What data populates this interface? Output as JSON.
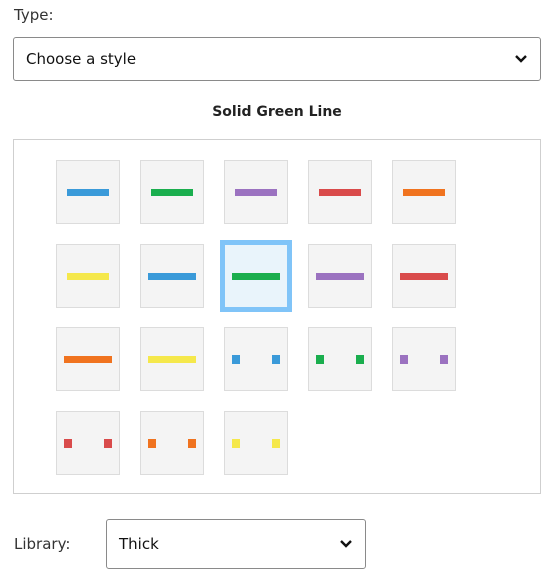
{
  "type": {
    "label": "Type:",
    "selected": "Choose a style"
  },
  "style_title": "Solid Green Line",
  "swatches": [
    {
      "name": "solid-blue-line",
      "kind": "solid",
      "color": "#3a9ad9"
    },
    {
      "name": "solid-green-line",
      "kind": "solid",
      "color": "#1aae4e"
    },
    {
      "name": "solid-purple-line",
      "kind": "solid",
      "color": "#9b72c0"
    },
    {
      "name": "solid-red-line",
      "kind": "solid",
      "color": "#d94b4b"
    },
    {
      "name": "solid-orange-line",
      "kind": "solid",
      "color": "#f0731f"
    },
    {
      "name": "solid-yellow-line",
      "kind": "solid",
      "color": "#f5e84b"
    },
    {
      "name": "solid-blue-line-long",
      "kind": "solid-long",
      "color": "#3a9ad9"
    },
    {
      "name": "solid-green-line-long",
      "kind": "solid-long",
      "color": "#1aae4e",
      "selected": true
    },
    {
      "name": "solid-purple-line-long",
      "kind": "solid-long",
      "color": "#9b72c0"
    },
    {
      "name": "solid-red-line-long",
      "kind": "solid-long",
      "color": "#d94b4b"
    },
    {
      "name": "solid-orange-line-long",
      "kind": "solid-long",
      "color": "#f0731f"
    },
    {
      "name": "solid-yellow-line-long",
      "kind": "solid-long",
      "color": "#f5e84b"
    },
    {
      "name": "dashed-blue-line",
      "kind": "dashed",
      "color": "#3a9ad9"
    },
    {
      "name": "dashed-green-line",
      "kind": "dashed",
      "color": "#1aae4e"
    },
    {
      "name": "dashed-purple-line",
      "kind": "dashed",
      "color": "#9b72c0"
    },
    {
      "name": "dashed-red-line",
      "kind": "dashed",
      "color": "#d94b4b"
    },
    {
      "name": "dashed-orange-line",
      "kind": "dashed",
      "color": "#f0731f"
    },
    {
      "name": "dashed-yellow-line",
      "kind": "dashed",
      "color": "#f5e84b"
    }
  ],
  "library": {
    "label": "Library:",
    "selected": "Thick"
  },
  "icons": {
    "dropdown": "chevron-down-icon"
  }
}
